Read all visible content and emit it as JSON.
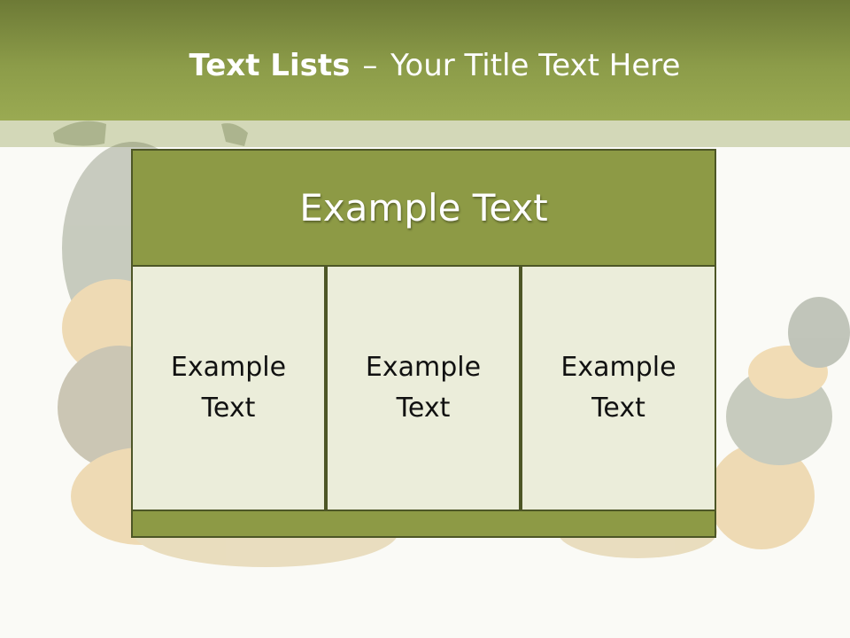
{
  "slide": {
    "title_bold": "Text Lists",
    "title_separator": "–",
    "title_rest": "Your Title Text Here"
  },
  "diagram": {
    "header_text": "Example Text",
    "columns": [
      {
        "text": "Example Text"
      },
      {
        "text": "Example Text"
      },
      {
        "text": "Example Text"
      }
    ]
  },
  "colors": {
    "header_green": "#8c9c49",
    "band": "#d3d8b8",
    "box_green": "#8d9a45",
    "cell_fill": "#ebedda",
    "border": "#4d5626"
  }
}
